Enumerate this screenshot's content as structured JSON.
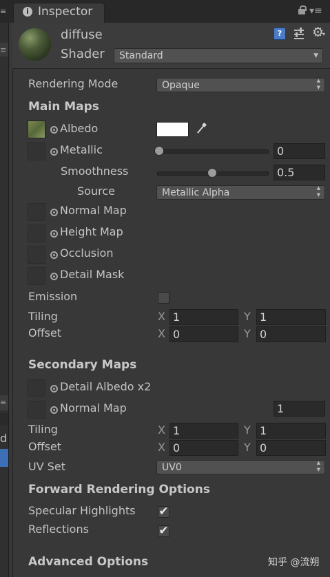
{
  "tab": {
    "title": "Inspector"
  },
  "material": {
    "name": "diffuse",
    "shader_label": "Shader",
    "shader_value": "Standard"
  },
  "rendering_mode": {
    "label": "Rendering Mode",
    "value": "Opaque"
  },
  "main_maps": {
    "title": "Main Maps",
    "albedo": "Albedo",
    "albedo_color": "#ffffff",
    "metallic": {
      "label": "Metallic",
      "value": "0",
      "level": 0
    },
    "smoothness": {
      "label": "Smoothness",
      "value": "0.5",
      "level": 0.5
    },
    "source": {
      "label": "Source",
      "value": "Metallic Alpha"
    },
    "normal_map": "Normal Map",
    "height_map": "Height Map",
    "occlusion": "Occlusion",
    "detail_mask": "Detail Mask",
    "emission": "Emission",
    "emission_checked": false,
    "tiling": {
      "label": "Tiling",
      "x": "1",
      "y": "1"
    },
    "offset": {
      "label": "Offset",
      "x": "0",
      "y": "0"
    }
  },
  "axis": {
    "x": "X",
    "y": "Y"
  },
  "secondary_maps": {
    "title": "Secondary Maps",
    "detail_albedo": "Detail Albedo x2",
    "normal_map": "Normal Map",
    "normal_scale": "1",
    "tiling": {
      "label": "Tiling",
      "x": "1",
      "y": "1"
    },
    "offset": {
      "label": "Offset",
      "x": "0",
      "y": "0"
    },
    "uv_set": {
      "label": "UV Set",
      "value": "UV0"
    }
  },
  "forward_rendering": {
    "title": "Forward Rendering Options",
    "specular_highlights": "Specular Highlights",
    "specular_checked": true,
    "reflections": "Reflections",
    "reflections_checked": true
  },
  "advanced": {
    "title": "Advanced Options"
  },
  "watermark": "知乎 @流朔",
  "colors": {
    "panel": "#383838",
    "header": "#3c3c3c",
    "tabbar": "#282828",
    "selection": "#3d6fb6"
  }
}
